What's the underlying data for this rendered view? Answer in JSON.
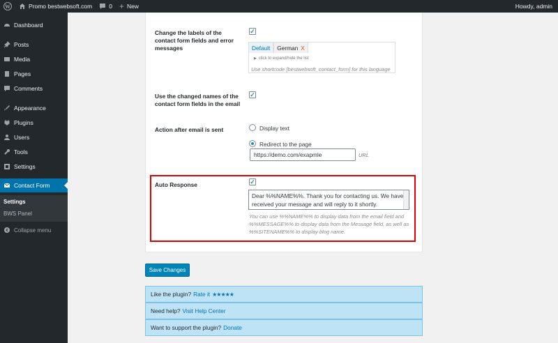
{
  "adminbar": {
    "site_name": "Promo bestwebsoft.com",
    "comments_count": "0",
    "new_label": "New",
    "greeting": "Howdy, admin"
  },
  "sidebar": {
    "items": [
      {
        "label": "Dashboard",
        "icon": "dashboard-icon"
      },
      {
        "label": "Posts",
        "icon": "pin-icon"
      },
      {
        "label": "Media",
        "icon": "media-icon"
      },
      {
        "label": "Pages",
        "icon": "pages-icon"
      },
      {
        "label": "Comments",
        "icon": "comment-icon"
      },
      {
        "label": "Appearance",
        "icon": "brush-icon"
      },
      {
        "label": "Plugins",
        "icon": "plugin-icon"
      },
      {
        "label": "Users",
        "icon": "user-icon"
      },
      {
        "label": "Tools",
        "icon": "wrench-icon"
      },
      {
        "label": "Settings",
        "icon": "settings-icon"
      },
      {
        "label": "Contact Form",
        "icon": "envelope-icon"
      }
    ],
    "submenu": [
      "Settings",
      "BWS Panel"
    ],
    "collapse_label": "Collapse menu"
  },
  "form": {
    "change_labels": "Change the labels of the contact form fields and error messages",
    "lang_tab_default": "Default",
    "lang_tab_german": "German",
    "lang_remove": "X",
    "expand_hint": "click to expand/hide the list",
    "shortcode_hint": "Use shortcode [bestwebsoft_contact_form] for this language",
    "use_changed_names": "Use the changed names of the contact form fields in the email",
    "action_after": "Action after email is sent",
    "display_text": "Display text",
    "redirect_page": "Redirect to the page",
    "url_value": "https://demo.com/exapmle",
    "url_label": "URL",
    "auto_response": "Auto Response",
    "auto_response_text": "Dear %%NAME%%. Thank you for contacting us. We have received your message and will reply to it shortly.",
    "auto_response_hint": "You can use %%NAME%% to display data from the email field and %%MESSAGE%% to display data from the Message field, as well as %%SITENAME%% to display blog name."
  },
  "save_label": "Save Changes",
  "info": {
    "like_text": "Like the plugin?",
    "rate_link": "Rate it",
    "stars": "★★★★★",
    "help_text": "Need help?",
    "help_link": "Visit Help Center",
    "support_text": "Want to support the plugin?",
    "donate_link": "Donate"
  },
  "colors": {
    "accent": "#0073aa",
    "highlight_border": "#e00000",
    "sidebar_bg": "#23282d"
  }
}
